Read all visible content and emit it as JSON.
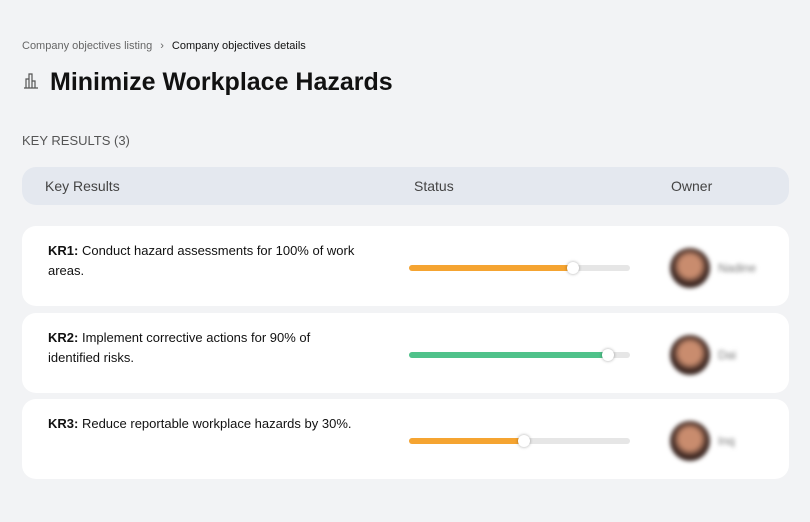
{
  "breadcrumb": {
    "parent": "Company objectives listing",
    "separator": "›",
    "current": "Company objectives details"
  },
  "title": "Minimize Workplace Hazards",
  "section": "KEY RESULTS (3)",
  "columns": {
    "key_results": "Key Results",
    "status": "Status",
    "owner": "Owner"
  },
  "rows": [
    {
      "id": "KR1:",
      "text": " Conduct hazard assessments for 100% of work areas.",
      "progress": 74,
      "color": "#f5a431",
      "owner": "Nadine"
    },
    {
      "id": "KR2:",
      "text": " Implement corrective actions for 90% of identified risks.",
      "progress": 90,
      "color": "#4fc28a",
      "owner": "Dai"
    },
    {
      "id": "KR3:",
      "text": " Reduce reportable workplace hazards by 30%.",
      "progress": 52,
      "color": "#f5a431",
      "owner": "Inq"
    }
  ]
}
